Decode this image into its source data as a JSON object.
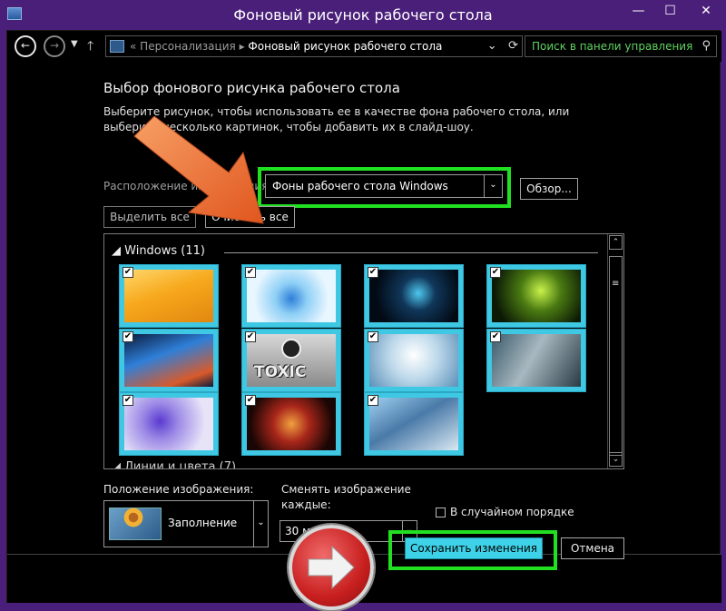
{
  "window": {
    "title": "Фоновый рисунок рабочего стола",
    "buttons": {
      "minimize": "—",
      "maximize": "☐",
      "close": "✕"
    },
    "accent": "#4a1f7a"
  },
  "nav": {
    "back_icon": "back-arrow-icon",
    "forward_icon": "forward-arrow-icon",
    "address": {
      "separator": "«",
      "crumb1": "Персонализация",
      "crumb_sep": "▸",
      "crumb2": "Фоновый рисунок рабочего стола"
    },
    "search": {
      "placeholder": "Поиск в панели управления"
    }
  },
  "main": {
    "heading": "Выбор фонового рисунка рабочего стола",
    "description": "Выберите рисунок, чтобы использовать ее в качестве фона рабочего стола, или выберите несколько картинок, чтобы добавить их в слайд-шоу.",
    "location_label": "Расположение изображения:",
    "location_value": "Фоны рабочего стола Windows",
    "browse_label": "Обзор...",
    "select_all_label": "Выделить все",
    "clear_all_label": "Очистить все"
  },
  "gallery": {
    "group1": "Windows (11)",
    "group2": "Линии и цвета (7)",
    "tiles": [
      {
        "name": "orange-abstract",
        "checked": true
      },
      {
        "name": "ice-cube",
        "checked": true
      },
      {
        "name": "blue-dragon",
        "checked": true
      },
      {
        "name": "green-hexagons",
        "checked": true
      },
      {
        "name": "blue-streaks",
        "checked": true
      },
      {
        "name": "toxic",
        "checked": true
      },
      {
        "name": "glass-flower",
        "checked": true
      },
      {
        "name": "kiss-portrait",
        "checked": true
      },
      {
        "name": "purple-flowers",
        "checked": true
      },
      {
        "name": "red-swirl",
        "checked": true
      },
      {
        "name": "fantasy-couple",
        "checked": true
      }
    ]
  },
  "position": {
    "label": "Положение изображения:",
    "value": "Заполнение"
  },
  "interval": {
    "label_line1": "Сменять изображение",
    "label_line2": "каждые:",
    "value": "30 минут"
  },
  "shuffle": {
    "label": "В случайном порядке",
    "checked": false
  },
  "footer": {
    "save_label": "Сохранить изменения",
    "cancel_label": "Отмена"
  },
  "annotations": {
    "highlight_color": "#21e021",
    "arrow_color": "#f07a3a",
    "circle_color": "#c81f1f"
  }
}
